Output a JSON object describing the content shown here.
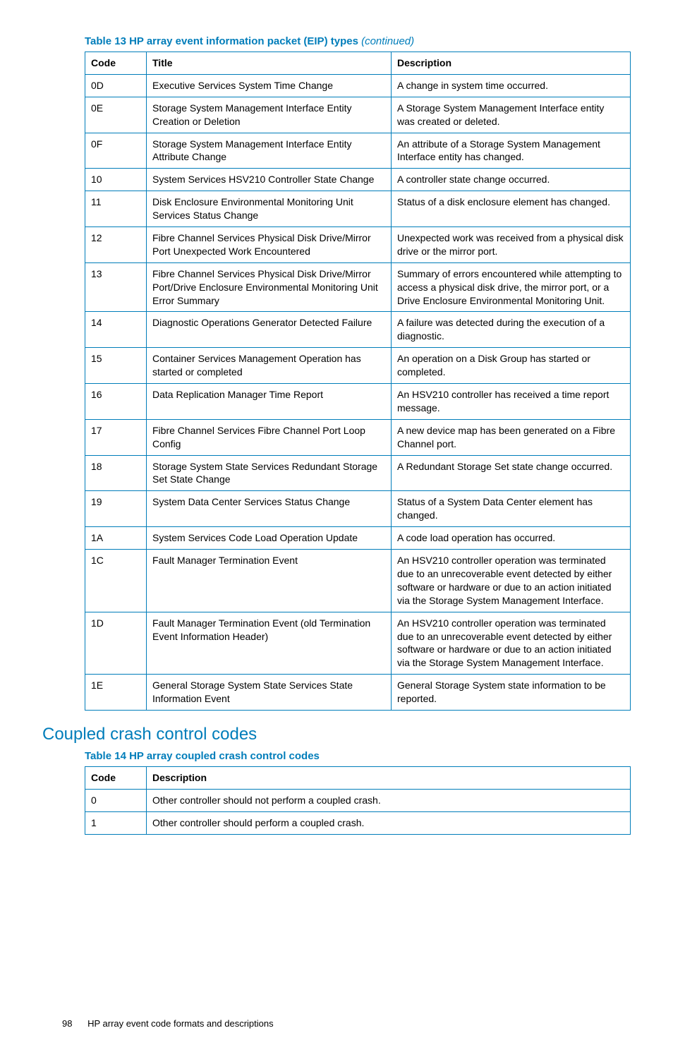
{
  "table13": {
    "caption_main": "Table 13 HP array event information packet (EIP) types",
    "caption_suffix": "(continued)",
    "headers": {
      "code": "Code",
      "title": "Title",
      "desc": "Description"
    },
    "rows": [
      {
        "code": "0D",
        "title": "Executive Services System Time Change",
        "desc": "A change in system time occurred."
      },
      {
        "code": "0E",
        "title": "Storage System Management Interface Entity Creation or Deletion",
        "desc": "A Storage System Management Interface entity was created or deleted."
      },
      {
        "code": "0F",
        "title": "Storage System Management Interface Entity Attribute Change",
        "desc": "An attribute of a Storage System Management Interface entity has changed."
      },
      {
        "code": "10",
        "title": "System Services HSV210 Controller State Change",
        "desc": "A controller state change occurred."
      },
      {
        "code": "11",
        "title": "Disk Enclosure Environmental Monitoring Unit Services Status Change",
        "desc": "Status of a disk enclosure element has changed."
      },
      {
        "code": "12",
        "title": "Fibre Channel Services Physical Disk Drive/Mirror Port Unexpected Work Encountered",
        "desc": "Unexpected work was received from a physical disk drive or the mirror port."
      },
      {
        "code": "13",
        "title": "Fibre Channel Services Physical Disk Drive/Mirror Port/Drive Enclosure Environmental Monitoring Unit Error Summary",
        "desc": "Summary of errors encountered while attempting to access a physical disk drive, the mirror port, or a Drive Enclosure Environmental Monitoring Unit."
      },
      {
        "code": "14",
        "title": "Diagnostic Operations Generator Detected Failure",
        "desc": "A failure was detected during the execution of a diagnostic."
      },
      {
        "code": "15",
        "title": "Container Services Management Operation has started or completed",
        "desc": "An operation on a Disk Group has started or completed."
      },
      {
        "code": "16",
        "title": "Data Replication Manager Time Report",
        "desc": "An HSV210 controller has received a time report message."
      },
      {
        "code": "17",
        "title": "Fibre Channel Services Fibre Channel Port Loop Config",
        "desc": "A new device map has been generated on a Fibre Channel port."
      },
      {
        "code": "18",
        "title": "Storage System State Services Redundant Storage Set State Change",
        "desc": "A Redundant Storage Set state change occurred."
      },
      {
        "code": "19",
        "title": "System Data Center Services Status Change",
        "desc": "Status of a System Data Center element has changed."
      },
      {
        "code": "1A",
        "title": "System Services Code Load Operation Update",
        "desc": "A code load operation has occurred."
      },
      {
        "code": "1C",
        "title": "Fault Manager Termination Event",
        "desc": "An HSV210 controller operation was terminated due to an unrecoverable event detected by either software or hardware or due to an action initiated via the Storage System Management Interface."
      },
      {
        "code": "1D",
        "title": "Fault Manager Termination Event (old Termination Event Information Header)",
        "desc": "An HSV210 controller operation was terminated due to an unrecoverable event detected by either software or hardware or due to an action initiated via the Storage System Management Interface."
      },
      {
        "code": "1E",
        "title": "General Storage System State Services State Information Event",
        "desc": "General Storage System state information to be reported."
      }
    ]
  },
  "section_heading": "Coupled crash control codes",
  "table14": {
    "caption": "Table 14 HP array coupled crash control codes",
    "headers": {
      "code": "Code",
      "desc": "Description"
    },
    "rows": [
      {
        "code": "0",
        "desc": "Other controller should not perform a coupled crash."
      },
      {
        "code": "1",
        "desc": "Other controller should perform a coupled crash."
      }
    ]
  },
  "footer": {
    "page": "98",
    "title": "HP array event code formats and descriptions"
  }
}
